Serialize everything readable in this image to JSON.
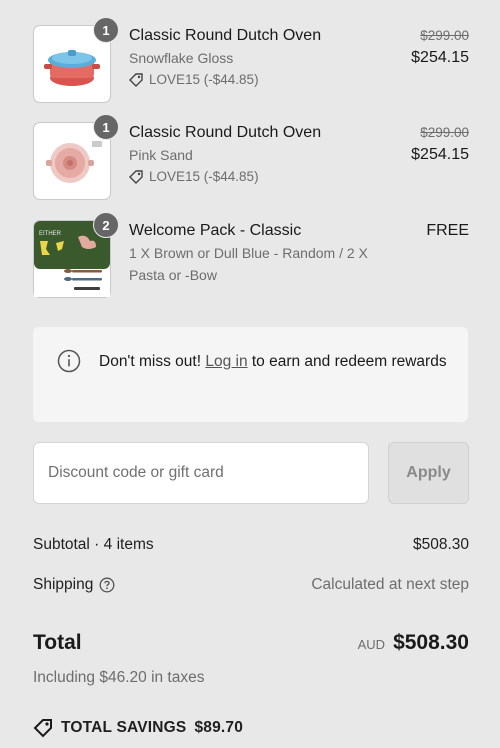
{
  "items": [
    {
      "title": "Classic Round Dutch Oven",
      "variant": "Snowflake Gloss",
      "discount": "LOVE15 (-$44.85)",
      "original_price": "$299.00",
      "price": "$254.15",
      "quantity": "1",
      "image": "dutch-oven-blue-lid"
    },
    {
      "title": "Classic Round Dutch Oven",
      "variant": "Pink Sand",
      "discount": "LOVE15 (-$44.85)",
      "original_price": "$299.00",
      "price": "$254.15",
      "quantity": "1",
      "image": "dutch-oven-pink-top"
    },
    {
      "title": "Welcome Pack - Classic",
      "variant_line1": "1 X Brown or Dull Blue - Random / 2 X",
      "variant_line2": "Pasta or -Bow",
      "price": "FREE",
      "quantity": "2",
      "image": "welcome-pack-card",
      "image_text": "EITHER"
    }
  ],
  "notice": {
    "before": "Don't miss out! ",
    "link": "Log in",
    "after": " to earn and redeem rewards",
    "icon": "info-icon"
  },
  "discount_code": {
    "placeholder": "Discount code or gift card",
    "value": "",
    "apply_label": "Apply"
  },
  "summary": {
    "subtotal_label": "Subtotal · 4 items",
    "subtotal_value": "$508.30",
    "shipping_label": "Shipping",
    "shipping_value": "Calculated at next step",
    "total_label": "Total",
    "currency": "AUD",
    "total_value": "$508.30",
    "taxes_note": "Including $46.20 in taxes",
    "savings_label": "TOTAL SAVINGS",
    "savings_value": "$89.70"
  },
  "colors": {
    "background": "#e8e8e8",
    "qty_badge": "#666666",
    "text": "#1a1a1a",
    "muted": "#6d6d6d"
  }
}
